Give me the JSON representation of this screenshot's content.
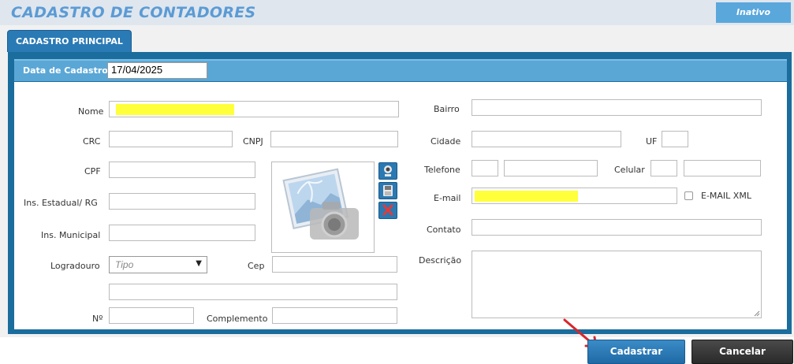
{
  "header": {
    "title": "CADASTRO DE CONTADORES",
    "status": "Inativo"
  },
  "tab": {
    "label": "CADASTRO PRINCIPAL"
  },
  "date_bar": {
    "label": "Data de Cadastro",
    "value": "17/04/2025"
  },
  "left": {
    "nome_label": "Nome",
    "crc_label": "CRC",
    "cnpj_label": "CNPJ",
    "cpf_label": "CPF",
    "ie_label": "Ins. Estadual/ RG",
    "im_label": "Ins. Municipal",
    "logradouro_label": "Logradouro",
    "logradouro_placeholder": "Tipo",
    "cep_label": "Cep",
    "numero_label": "Nº",
    "complemento_label": "Complemento"
  },
  "right": {
    "bairro_label": "Bairro",
    "cidade_label": "Cidade",
    "uf_label": "UF",
    "telefone_label": "Telefone",
    "celular_label": "Celular",
    "email_label": "E-mail",
    "email_xml_label": "E-MAIL XML",
    "contato_label": "Contato",
    "descricao_label": "Descrição"
  },
  "photo": {
    "icons": [
      "webcam-icon",
      "save-icon",
      "delete-icon"
    ],
    "placeholder_icon": "camera-placeholder-icon"
  },
  "actions": {
    "submit": "Cadastrar",
    "cancel": "Cancelar"
  },
  "colors": {
    "accent": "#2a79b3",
    "highlight": "#ffff3a",
    "title": "#5b9bd5",
    "arrow": "#d9262c"
  }
}
